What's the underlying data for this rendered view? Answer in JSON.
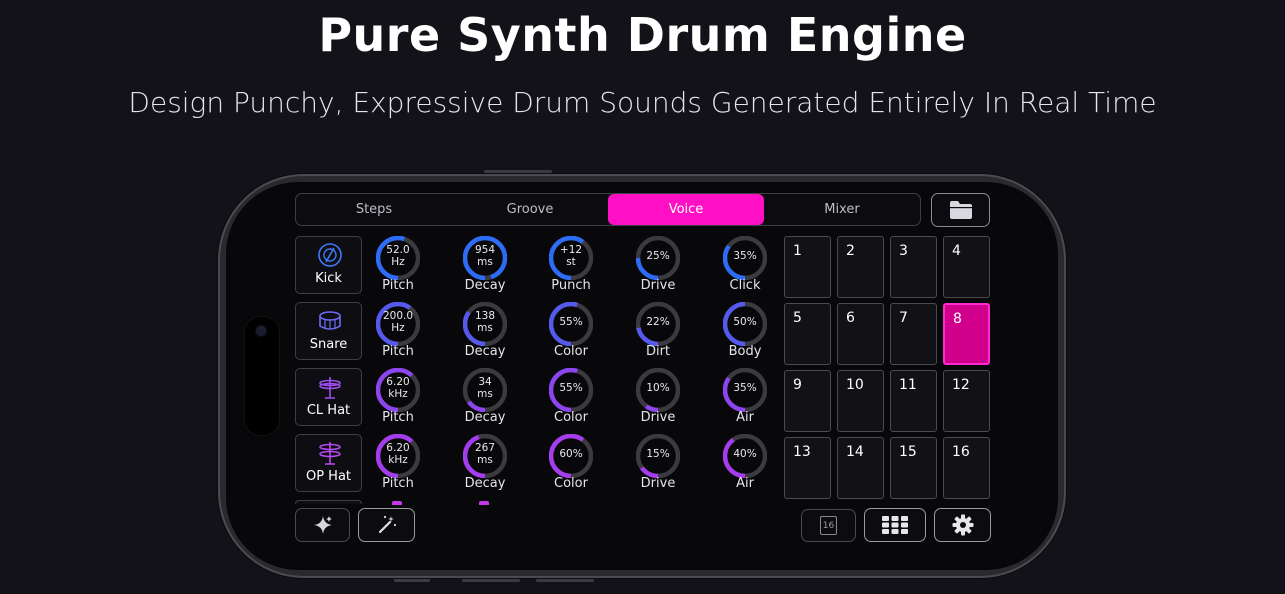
{
  "header": {
    "title": "Pure Synth Drum Engine",
    "subtitle": "Design Punchy, Expressive Drum Sounds Generated Entirely In Real Time"
  },
  "tabs": [
    {
      "label": "Steps",
      "active": false
    },
    {
      "label": "Groove",
      "active": false
    },
    {
      "label": "Voice",
      "active": true
    },
    {
      "label": "Mixer",
      "active": false
    }
  ],
  "voices": [
    {
      "label": "Kick",
      "icon": "kick-drum-icon",
      "color": "#2f6df5"
    },
    {
      "label": "Snare",
      "icon": "snare-drum-icon",
      "color": "#5a5df2"
    },
    {
      "label": "CL Hat",
      "icon": "closed-hihat-icon",
      "color": "#9a45f0"
    },
    {
      "label": "OP Hat",
      "icon": "open-hihat-icon",
      "color": "#b43cf0"
    }
  ],
  "knob_rows": [
    {
      "color": "#2c6cf6",
      "knobs": [
        {
          "value": "52.0\nHz",
          "label": "Pitch",
          "level": 0.55
        },
        {
          "value": "954\nms",
          "label": "Decay",
          "level": 0.95
        },
        {
          "value": "+12\nst",
          "label": "Punch",
          "level": 0.6
        },
        {
          "value": "25%",
          "label": "Drive",
          "level": 0.25
        },
        {
          "value": "35%",
          "label": "Click",
          "level": 0.35
        }
      ]
    },
    {
      "color": "#5659ee",
      "knobs": [
        {
          "value": "200.0\nHz",
          "label": "Pitch",
          "level": 0.6
        },
        {
          "value": "138\nms",
          "label": "Decay",
          "level": 0.35
        },
        {
          "value": "55%",
          "label": "Color",
          "level": 0.55
        },
        {
          "value": "22%",
          "label": "Dirt",
          "level": 0.22
        },
        {
          "value": "50%",
          "label": "Body",
          "level": 0.5
        }
      ]
    },
    {
      "color": "#8d45ef",
      "knobs": [
        {
          "value": "6.20\nkHz",
          "label": "Pitch",
          "level": 0.62
        },
        {
          "value": "34\nms",
          "label": "Decay",
          "level": 0.15
        },
        {
          "value": "55%",
          "label": "Color",
          "level": 0.55
        },
        {
          "value": "10%",
          "label": "Drive",
          "level": 0.1
        },
        {
          "value": "35%",
          "label": "Air",
          "level": 0.35
        }
      ]
    },
    {
      "color": "#a63cef",
      "knobs": [
        {
          "value": "6.20\nkHz",
          "label": "Pitch",
          "level": 0.62
        },
        {
          "value": "267\nms",
          "label": "Decay",
          "level": 0.45
        },
        {
          "value": "60%",
          "label": "Color",
          "level": 0.6
        },
        {
          "value": "15%",
          "label": "Drive",
          "level": 0.15
        },
        {
          "value": "40%",
          "label": "Air",
          "level": 0.4
        }
      ]
    }
  ],
  "pads": [
    {
      "label": "1"
    },
    {
      "label": "2"
    },
    {
      "label": "3"
    },
    {
      "label": "4"
    },
    {
      "label": "5"
    },
    {
      "label": "6"
    },
    {
      "label": "7"
    },
    {
      "label": "8",
      "active": true
    },
    {
      "label": "9"
    },
    {
      "label": "10"
    },
    {
      "label": "11"
    },
    {
      "label": "12"
    },
    {
      "label": "13"
    },
    {
      "label": "14"
    },
    {
      "label": "15"
    },
    {
      "label": "16"
    }
  ],
  "bottom_bar": {
    "sparkle_icon": "sparkle-icon",
    "magic_wand_icon": "magic-wand-icon",
    "step_length_label": "16",
    "grid_icon": "grid-icon",
    "settings_icon": "gear-icon"
  },
  "colors": {
    "accent": "#ff10c4",
    "pad_active": "#d0008c",
    "track": "#3a3a40"
  }
}
